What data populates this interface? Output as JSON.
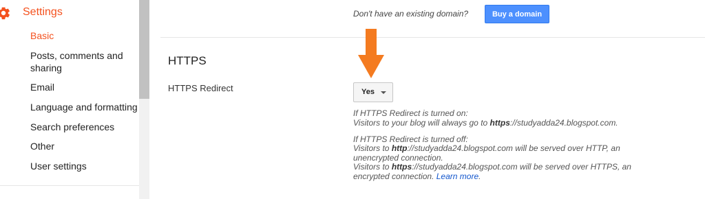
{
  "sidebar": {
    "title": "Settings",
    "items": [
      {
        "label": "Basic",
        "active": true
      },
      {
        "label": "Posts, comments and sharing"
      },
      {
        "label": "Email"
      },
      {
        "label": "Language and formatting"
      },
      {
        "label": "Search preferences"
      },
      {
        "label": "Other"
      },
      {
        "label": "User settings"
      }
    ]
  },
  "domain": {
    "prompt": "Don't have an existing domain?",
    "buy_label": "Buy a domain"
  },
  "https": {
    "section_title": "HTTPS",
    "redirect_label": "HTTPS Redirect",
    "redirect_value": "Yes",
    "on_heading": "If HTTPS Redirect is turned on:",
    "on_line_pre": "Visitors to your blog will always go to ",
    "on_proto": "https",
    "on_line_post": "://studyadda24.blogspot.com.",
    "off_heading": "If HTTPS Redirect is turned off:",
    "off_line1_pre": "Visitors to ",
    "off_line1_proto": "http",
    "off_line1_post": "://studyadda24.blogspot.com will be served over HTTP, an",
    "off_line2": "unencrypted connection.",
    "off_line3_pre": "Visitors to ",
    "off_line3_proto": "https",
    "off_line3_post": "://studyadda24.blogspot.com will be served over HTTPS, an",
    "off_line4_pre": "encrypted connection. ",
    "learn_more": "Learn more",
    "off_line4_post": "."
  },
  "colors": {
    "accent": "#f4511e",
    "button_blue": "#4d90fe",
    "arrow_orange": "#f47b20",
    "link": "#1155cc"
  }
}
